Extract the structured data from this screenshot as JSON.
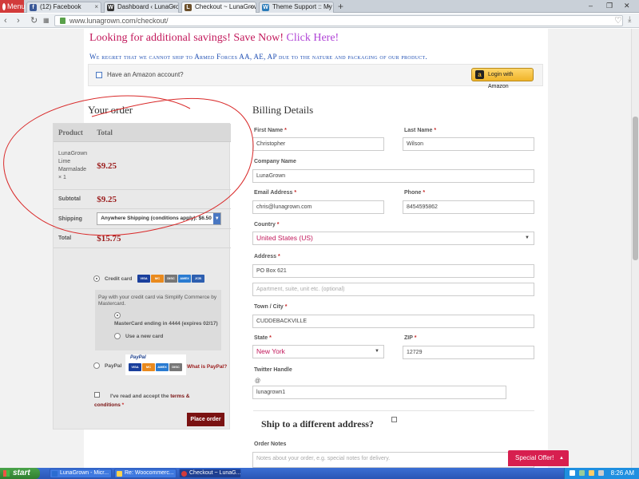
{
  "browser": {
    "menu_label": "Menu",
    "tabs": [
      {
        "label": "(12) Facebook",
        "icon": "facebook-icon"
      },
      {
        "label": "Dashboard ‹ LunaGrown",
        "icon": "wordpress-icon"
      },
      {
        "label": "Checkout ~ LunaGrown",
        "icon": "lunagrown-icon",
        "active": true
      },
      {
        "label": "Theme Support :: My Th",
        "icon": "wordpress-icon"
      }
    ],
    "url": "www.lunagrown.com/checkout/"
  },
  "page": {
    "promo_text": "Looking for additional savings! Save Now!",
    "promo_link": "Click Here!",
    "notice": "We regret that we cannot ship to Armed Forces AA, AE, AP due to the nature and packaging of our product.",
    "amazon_question": "Have an Amazon account?",
    "amazon_button": "Login with Amazon",
    "amazon_logo": "a"
  },
  "order": {
    "title": "Your order",
    "col_product": "Product",
    "col_total": "Total",
    "item_line1": "LunaGrown",
    "item_line2": "Lime",
    "item_line3": "Marmalade",
    "item_qty": "× 1",
    "item_total": "$9.25",
    "subtotal_label": "Subtotal",
    "subtotal": "$9.25",
    "shipping_label": "Shipping",
    "shipping_option": "Anywhere Shipping (conditions apply): $6.50",
    "total_label": "Total",
    "total": "$15.75",
    "payment_credit_card": "Credit card",
    "card_brands": [
      "VISA",
      "MC",
      "DISC",
      "AMEX",
      "JCB"
    ],
    "pay_description": "Pay with your credit card via Simplify Commerce by Mastercard.",
    "saved_card": "MasterCard ending in 4444 (expires 02/17)",
    "new_card": "Use a new card",
    "paypal_label": "PayPal",
    "paypal_logo": "PayPal",
    "what_is_paypal": "What is PayPal?",
    "terms_prefix": "I've read and accept the",
    "terms_link": "terms & conditions",
    "terms_req": "*",
    "place_order": "Place order"
  },
  "billing": {
    "title": "Billing Details",
    "first_name_label": "First Name",
    "first_name": "Christopher",
    "last_name_label": "Last Name",
    "last_name": "Wilson",
    "company_label": "Company Name",
    "company": "LunaGrown",
    "email_label": "Email Address",
    "email": "chris@lunagrown.com",
    "phone_label": "Phone",
    "phone": "8454595862",
    "country_label": "Country",
    "country": "United States (US)",
    "address_label": "Address",
    "address1": "PO Box 621",
    "address2_placeholder": "Apartment, suite, unit etc. (optional)",
    "city_label": "Town / City",
    "city": "CUDDEBACKVILLE",
    "state_label": "State",
    "state": "New York",
    "zip_label": "ZIP",
    "zip": "12729",
    "twitter_label": "Twitter Handle",
    "twitter_at": "@",
    "twitter": "lunagrown1",
    "ship_different": "Ship to a different address?",
    "order_notes_label": "Order Notes",
    "order_notes_placeholder": "Notes about your order, e.g. special notes for delivery.",
    "required_mark": "*"
  },
  "special_offer": "Special Offer!",
  "taskbar": {
    "start": "start",
    "items": [
      {
        "label": "LunaGrown - Micr..."
      },
      {
        "label": "Re: Woocommerc..."
      },
      {
        "label": "Checkout ~ LunaG...",
        "active": true
      }
    ],
    "time": "8:26 AM"
  },
  "colors": {
    "promo": "#c2185b",
    "notice": "#1f4fb3",
    "price": "#9b1b1b",
    "place_order_bg": "#7a1212",
    "special_offer_bg": "#d71f4f",
    "annotation": "#d92a2a"
  }
}
